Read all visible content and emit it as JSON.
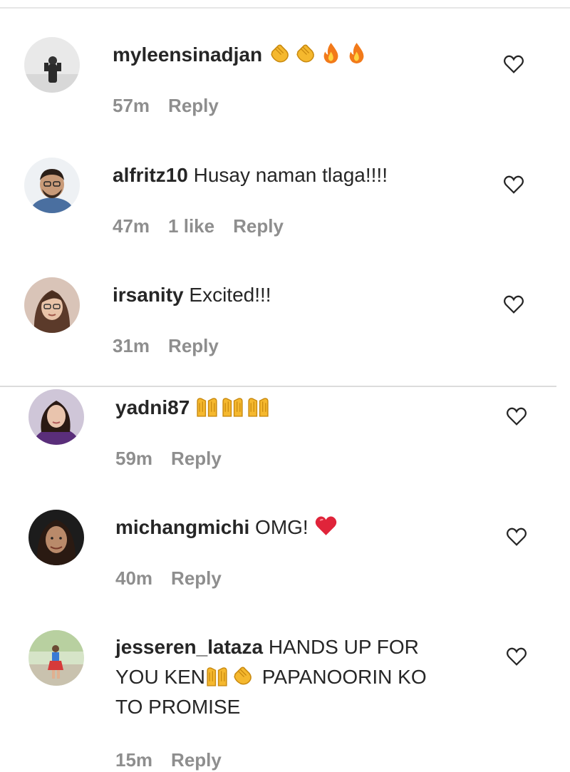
{
  "comments": [
    {
      "username": "myleensinadjan",
      "text": "",
      "emojis": [
        "clapping-hands",
        "clapping-hands",
        "fire",
        "fire"
      ],
      "time": "57m",
      "likes": "",
      "reply_label": "Reply"
    },
    {
      "username": "alfritz10",
      "text": " Husay naman tlaga!!!!",
      "emojis": [],
      "time": "47m",
      "likes": "1 like",
      "reply_label": "Reply"
    },
    {
      "username": "irsanity",
      "text": " Excited!!!",
      "emojis": [],
      "time": "31m",
      "likes": "",
      "reply_label": "Reply"
    },
    {
      "username": "yadni87",
      "text": "",
      "emojis": [
        "raising-hands",
        "raising-hands",
        "raising-hands"
      ],
      "time": "59m",
      "likes": "",
      "reply_label": "Reply"
    },
    {
      "username": "michangmichi",
      "text": " OMG! ",
      "emojis": [
        "red-heart"
      ],
      "time": "40m",
      "likes": "",
      "reply_label": "Reply"
    },
    {
      "username": "jesseren_lataza",
      "text_line1": " HANDS UP FOR",
      "text_line2_before": "YOU KEN",
      "emojis": [
        "raising-hands",
        "clapping-hands"
      ],
      "text_line2_after": " PAPANOORIN KO",
      "text_line3": "TO PROMISE",
      "time": "15m",
      "likes": "",
      "reply_label": "Reply"
    }
  ],
  "colors": {
    "text": "#262626",
    "meta": "#8e8e8e",
    "emoji": "#f5b82e",
    "fire": "#f27a1a",
    "heart": "#e0243a"
  },
  "icons": {
    "like": "heart-outline-icon"
  }
}
